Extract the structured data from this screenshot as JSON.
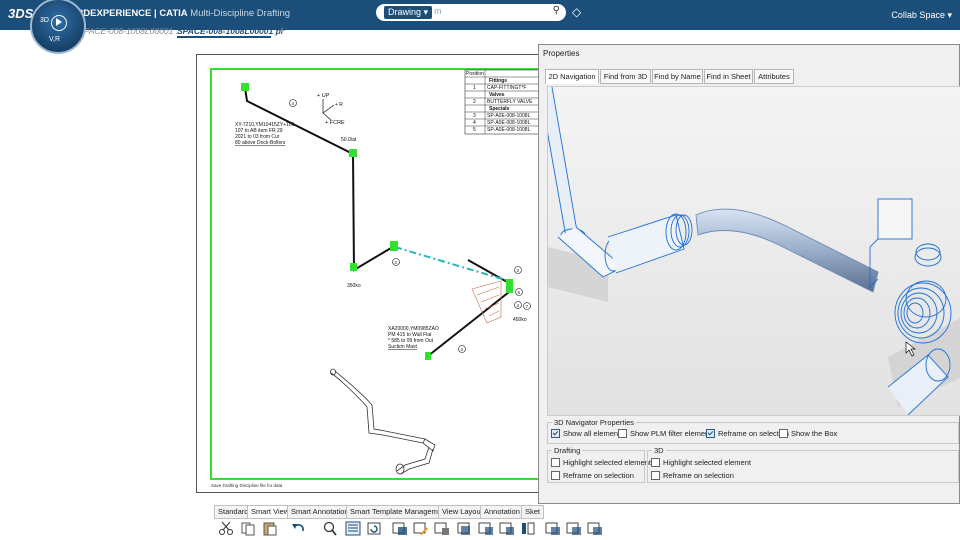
{
  "header": {
    "logo": "3DS",
    "brand": "3DEXPERIENCE | CATIA",
    "subtitle": "Multi-Discipline Drafting",
    "compass_labels": [
      "3D",
      "V,R"
    ],
    "search": {
      "scope": "Drawing",
      "placeholder": "m"
    },
    "user_space": "Collab Space"
  },
  "tabs": [
    {
      "label": "SPACE-008-1008L00001 ..."
    },
    {
      "label": "SPACE-008-1008L00001 pl"
    }
  ],
  "drawing": {
    "table": {
      "header": "Position",
      "sections": [
        "Fittings",
        "Valves",
        "Specials"
      ],
      "rows": [
        {
          "pos": "1",
          "desc": "CAP-FITTINGT*F"
        },
        {
          "pos": "2",
          "desc": "BUTTERFLY VALVE"
        },
        {
          "pos": "3",
          "desc": "SP-A0E-008-1008L"
        },
        {
          "pos": "4",
          "desc": "SP-A0E-008-1008L"
        },
        {
          "pos": "5",
          "desc": "SP-A0E-008-1008L"
        }
      ]
    },
    "note_top": [
      "XY-7210,YM10415ZY+109",
      "107 to AB item FR 29",
      "2021 to 03 from Cur",
      "80 above Dock-Bollers"
    ],
    "note_mid": [
      "XA20000,YM0985ZAO",
      "PM 415 to Wall Flat",
      "* 585 to 09 from Out",
      "Suction Mast"
    ],
    "axis_labels": {
      "up": "+ UP",
      "fore": "+ FCRE",
      "side": "+ R"
    },
    "dims": [
      "50.0/at",
      "350ko",
      "450ko"
    ],
    "bubbles": [
      "4",
      "2",
      "2",
      "5",
      "4",
      "7",
      "3"
    ],
    "footer_note": "Save Drafting Discipline file for data"
  },
  "properties": {
    "title": "Properties",
    "tabs": [
      "2D Navigation",
      "Find from 3D",
      "Find by Name",
      "Find in Sheet",
      "Attributes"
    ],
    "active_tab": "2D Navigation",
    "navigator_group": "3D Navigator Properties",
    "navigator_options": [
      {
        "label": "Show all elements",
        "checked": true
      },
      {
        "label": "Show PLM filter elements",
        "checked": false
      },
      {
        "label": "Reframe on selection",
        "checked": true
      },
      {
        "label": "Show the Box",
        "checked": false
      }
    ],
    "drafting_group": "Drafting",
    "drafting_options": [
      {
        "label": "Highlight selected element",
        "checked": false
      },
      {
        "label": "Reframe on selection",
        "checked": false
      }
    ],
    "threed_group": "3D",
    "threed_options": [
      {
        "label": "Highlight selected element",
        "checked": false
      },
      {
        "label": "Reframe on selection",
        "checked": false
      }
    ]
  },
  "bottom_tabs": [
    "Standard",
    "Smart View",
    "Smart Annotation",
    "Smart Template Management",
    "View Layout",
    "Annotation",
    "Sket"
  ],
  "active_bottom_tab": "Smart View",
  "toolbar_icons": [
    "cut-icon",
    "copy-icon",
    "paste-icon",
    "undo-icon",
    "zoom-icon",
    "sheet-icon",
    "update-icon",
    "view-icon-1",
    "view-icon-2",
    "view-icon-3",
    "view-icon-4",
    "view-icon-5",
    "view-icon-6",
    "view-icon-7",
    "view-icon-8",
    "view-icon-9",
    "view-icon-10"
  ],
  "colors": {
    "header_bg": "#1b4e79",
    "highlight_green": "#33e02f",
    "pipe_blue": "#1d6fd6"
  }
}
